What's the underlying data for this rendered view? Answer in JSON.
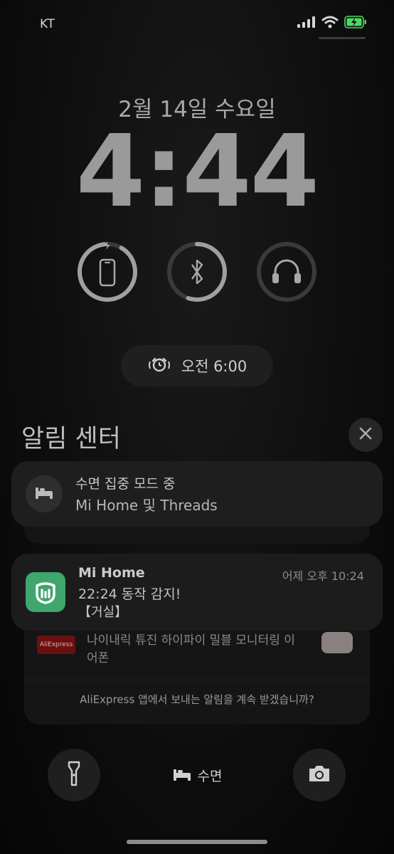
{
  "status_bar": {
    "carrier": "KT",
    "signal_icon": "signal-icon",
    "wifi_icon": "wifi-icon",
    "battery_icon": "battery-charging-icon",
    "battery_color": "#4cd964"
  },
  "lock_screen": {
    "date": "2월 14일 수요일",
    "time": "4:44"
  },
  "widgets": [
    {
      "icon": "iphone-charging-icon",
      "level": 0.9
    },
    {
      "icon": "bluetooth-icon",
      "level": 0.55
    },
    {
      "icon": "headphones-icon",
      "level": 0
    }
  ],
  "alarm": {
    "icon": "alarm-clock-icon",
    "label": "오전 6:00"
  },
  "notification_center": {
    "title": "알림 센터",
    "close_icon": "close-icon"
  },
  "focus_card": {
    "icon": "bed-icon",
    "title": "수면 집중 모드 중",
    "subtitle": "Mi Home 및 Threads"
  },
  "mi_home_notification": {
    "app": "Mi Home",
    "time": "어제 오후 10:24",
    "line1": "22:24 동작 감지!",
    "line2": "【거실】",
    "icon_color": "#3fa66e"
  },
  "aliexpress_notification": {
    "logo_text": "AliExpress",
    "text": "나이내릭 튜진 하이파이 밀블 모니터링 이어폰",
    "question": "AliExpress 앱에서 보내는 알림을 계속 받겠습니까?"
  },
  "bottom_bar": {
    "flashlight_icon": "flashlight-icon",
    "focus_icon": "bed-icon",
    "focus_label": "수면",
    "camera_icon": "camera-icon"
  }
}
